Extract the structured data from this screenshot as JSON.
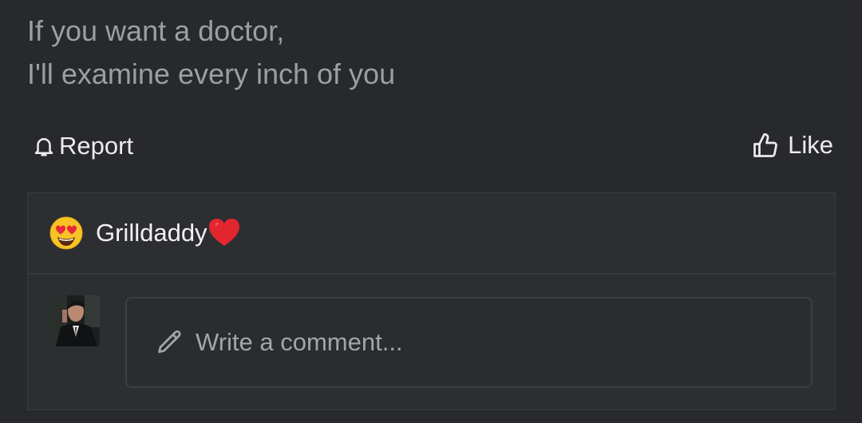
{
  "post": {
    "lines": [
      "If you want a doctor,",
      "I'll examine every inch of you"
    ]
  },
  "actions": {
    "report_label": "Report",
    "report_icon": "bell-icon",
    "like_label": "Like",
    "like_icon": "thumbs-up-icon"
  },
  "reaction": {
    "emoji": "heart-eyes-emoji",
    "name": "Grilldaddy",
    "suffix_icon": "red-heart-icon"
  },
  "comment": {
    "avatar": "user-avatar",
    "placeholder": "Write a comment...",
    "input_icon": "pencil-icon"
  },
  "colors": {
    "background": "#28292d",
    "panel": "#2d2e32",
    "muted_text": "#9c9ea3",
    "text": "#ececee",
    "heart": "#e3262e",
    "emoji_face": "#f7c325"
  }
}
